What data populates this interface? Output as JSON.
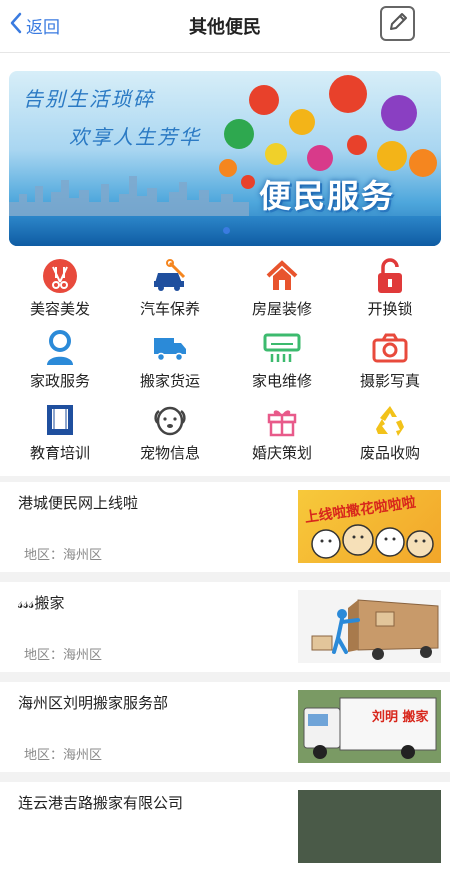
{
  "header": {
    "back_label": "返回",
    "title": "其他便民"
  },
  "banner": {
    "slogan_line1": "告别生活琐碎",
    "slogan_line2": "欢享人生芳华",
    "title": "便民服务"
  },
  "categories": [
    {
      "label": "美容美发",
      "icon": "scissors-icon",
      "color": "#e84a3c"
    },
    {
      "label": "汽车保养",
      "icon": "car-repair-icon",
      "color": "#1f4f9e"
    },
    {
      "label": "房屋装修",
      "icon": "house-icon",
      "color": "#e8542d"
    },
    {
      "label": "开换锁",
      "icon": "lock-icon",
      "color": "#e03a3a"
    },
    {
      "label": "家政服务",
      "icon": "housekeeper-icon",
      "color": "#2b8ad8"
    },
    {
      "label": "搬家货运",
      "icon": "truck-icon",
      "color": "#2b8ad8"
    },
    {
      "label": "家电维修",
      "icon": "air-conditioner-icon",
      "color": "#3cba6e"
    },
    {
      "label": "摄影写真",
      "icon": "camera-icon",
      "color": "#e84a3c"
    },
    {
      "label": "教育培训",
      "icon": "book-icon",
      "color": "#1f4f9e"
    },
    {
      "label": "宠物信息",
      "icon": "dog-icon",
      "color": "#444444"
    },
    {
      "label": "婚庆策划",
      "icon": "wedding-gift-icon",
      "color": "#e85a8a"
    },
    {
      "label": "废品收购",
      "icon": "recycle-icon",
      "color": "#f2c21a"
    }
  ],
  "listings": [
    {
      "title": "港城便民网上线啦",
      "region": "地区：海州区",
      "thumb_text": "上线啦撒花啦啦啦"
    },
    {
      "title": "𝓈𝓈𝓈搬家",
      "region": "地区：海州区",
      "thumb_text": ""
    },
    {
      "title": "海州区刘明搬家服务部",
      "region": "地区：海州区",
      "thumb_text": "刘明 搬家"
    },
    {
      "title": "连云港吉路搬家有限公司",
      "region": "",
      "thumb_text": ""
    }
  ]
}
